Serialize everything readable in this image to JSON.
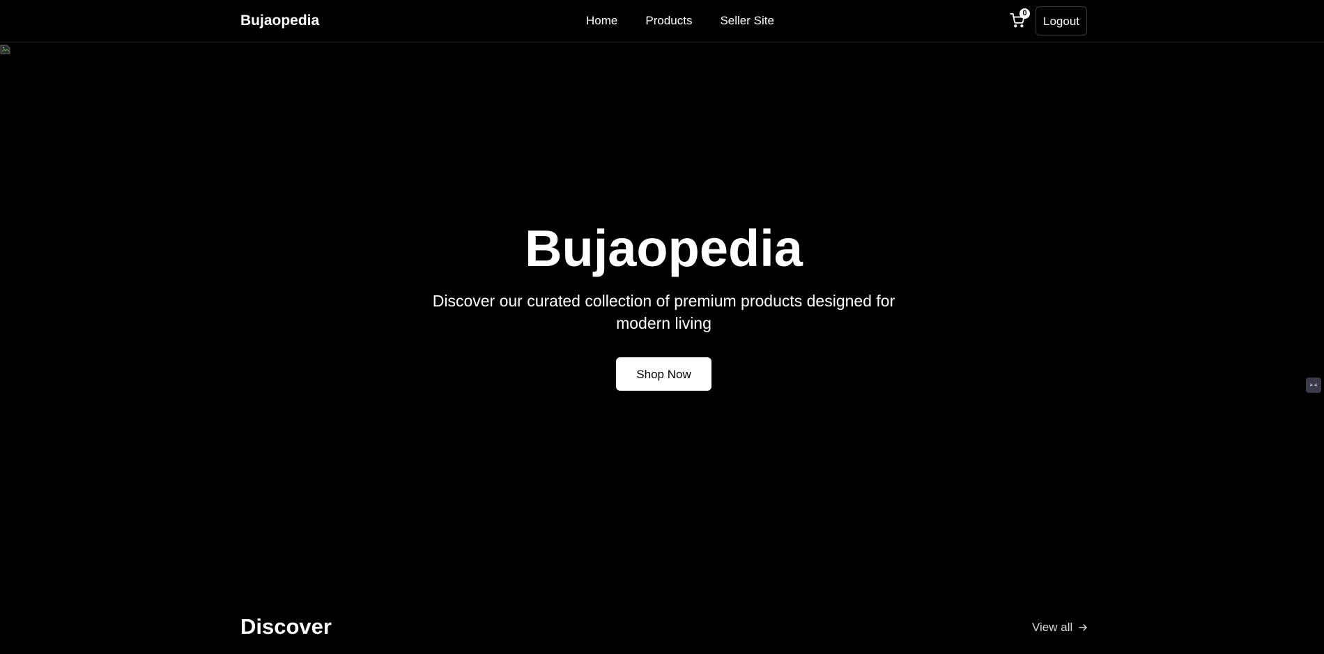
{
  "navbar": {
    "brand": "Bujaopedia",
    "links": [
      "Home",
      "Products",
      "Seller Site"
    ],
    "cart_count": "0",
    "cart_icon": "shopping-cart-icon",
    "logout_label": "Logout"
  },
  "hero": {
    "title": "Bujaopedia",
    "subtitle": "Discover our curated collection of premium products designed for modern living",
    "cta_label": "Shop Now"
  },
  "discover": {
    "title": "Discover",
    "view_all_label": "View all",
    "view_all_icon": "arrow-right-icon"
  },
  "colors": {
    "background": "#000000",
    "text": "#ffffff",
    "button_bg": "#ffffff",
    "button_text": "#000000",
    "border": "#3a3a3a"
  }
}
